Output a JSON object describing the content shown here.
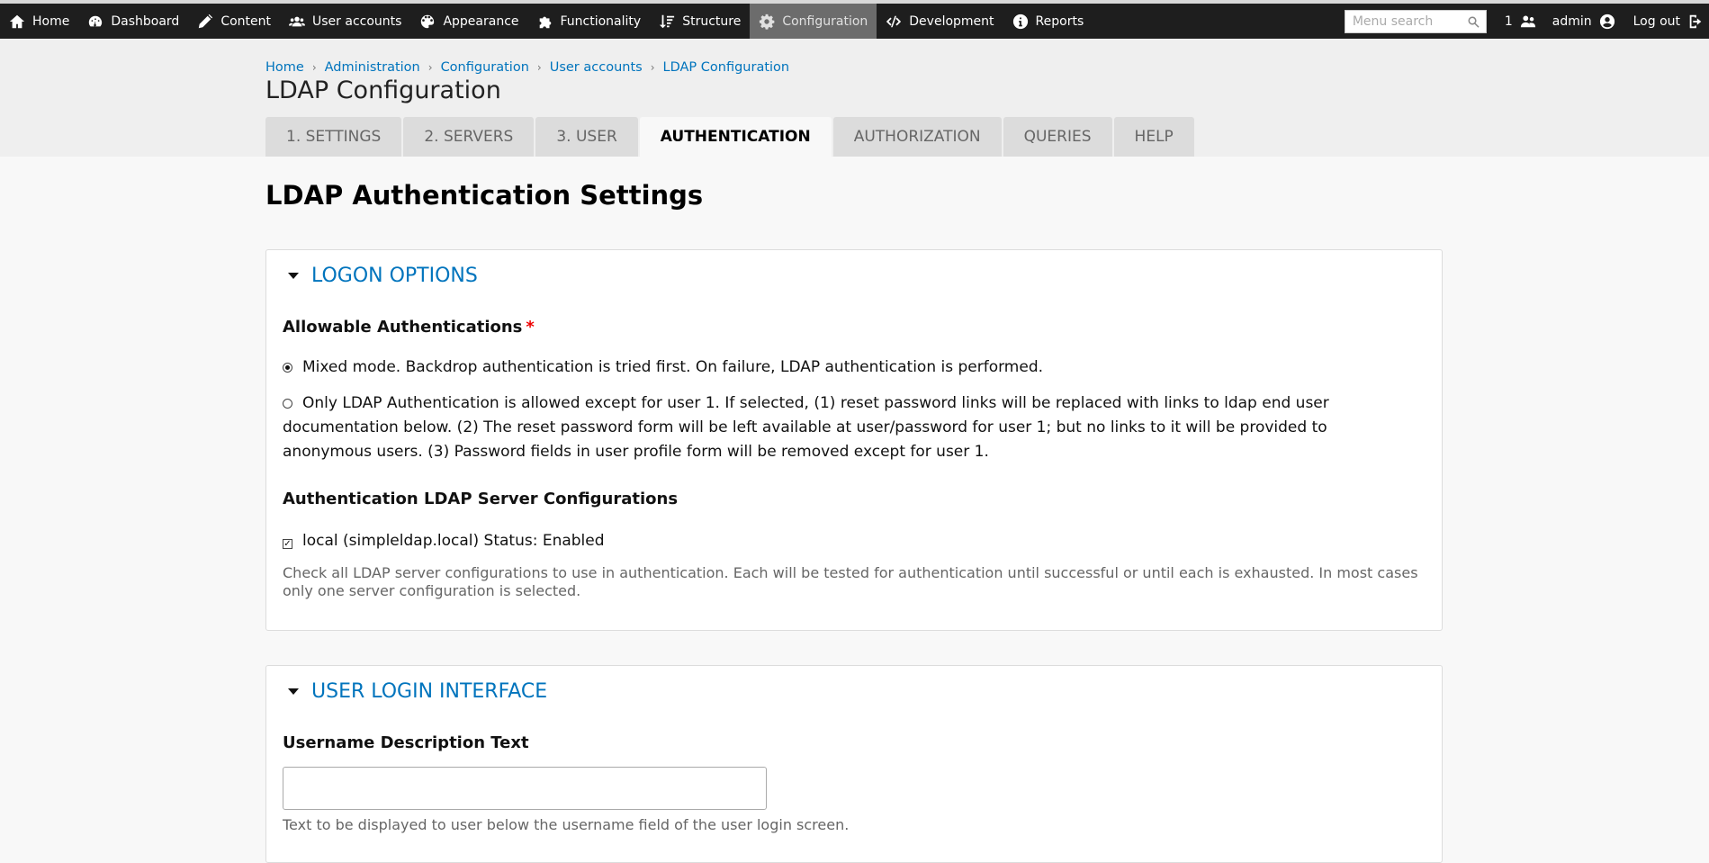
{
  "admin_bar": {
    "items": [
      {
        "label": "Home",
        "icon": "home-icon"
      },
      {
        "label": "Dashboard",
        "icon": "dashboard-icon"
      },
      {
        "label": "Content",
        "icon": "pencil-icon"
      },
      {
        "label": "User accounts",
        "icon": "users-icon"
      },
      {
        "label": "Appearance",
        "icon": "palette-icon"
      },
      {
        "label": "Functionality",
        "icon": "puzzle-icon"
      },
      {
        "label": "Structure",
        "icon": "sort-icon"
      },
      {
        "label": "Configuration",
        "icon": "gear-icon",
        "active": true
      },
      {
        "label": "Development",
        "icon": "code-icon"
      },
      {
        "label": "Reports",
        "icon": "info-icon"
      }
    ],
    "search_placeholder": "Menu search",
    "user_count": "1",
    "username": "admin",
    "logout_label": "Log out"
  },
  "breadcrumb": [
    "Home",
    "Administration",
    "Configuration",
    "User accounts",
    "LDAP Configuration"
  ],
  "page_title": "LDAP Configuration",
  "tabs": [
    {
      "label": "1. SETTINGS"
    },
    {
      "label": "2. SERVERS"
    },
    {
      "label": "3. USER"
    },
    {
      "label": "AUTHENTICATION",
      "active": true
    },
    {
      "label": "AUTHORIZATION"
    },
    {
      "label": "QUERIES"
    },
    {
      "label": "HELP"
    }
  ],
  "section_title": "LDAP Authentication Settings",
  "logon_options": {
    "legend": "LOGON OPTIONS",
    "allowable_label": "Allowable Authentications",
    "required_mark": "*",
    "options": [
      {
        "label": "Mixed mode. Backdrop authentication is tried first. On failure, LDAP authentication is performed.",
        "checked": true
      },
      {
        "label": "Only LDAP Authentication is allowed except for user 1. If selected, (1) reset password links will be replaced with links to ldap end user documentation below. (2) The reset password form will be left available at user/password for user 1; but no links to it will be provided to anonymous users. (3) Password fields in user profile form will be removed except for user 1.",
        "checked": false
      }
    ],
    "servers_label": "Authentication LDAP Server Configurations",
    "server_option": {
      "label": "local (simpleldap.local) Status: Enabled",
      "checked": true
    },
    "servers_description": "Check all LDAP server configurations to use in authentication. Each will be tested for authentication until successful or until each is exhausted. In most cases only one server configuration is selected."
  },
  "user_login_interface": {
    "legend": "USER LOGIN INTERFACE",
    "username_desc_label": "Username Description Text",
    "username_desc_value": "",
    "username_desc_help": "Text to be displayed to user below the username field of the user login screen."
  }
}
